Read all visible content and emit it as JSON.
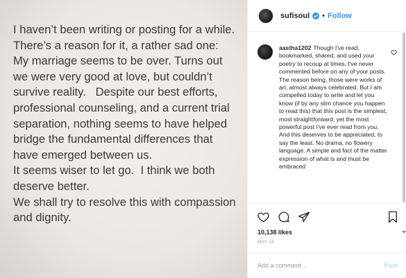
{
  "post": {
    "image_text": [
      "I haven’t been writing or posting for a while. There’s a reason for it, a rather sad one:  My marriage seems to be over. Turns out we were very good at love, but couldn’t survive reality.   Despite our best efforts, professional counseling, and a current trial separation, nothing seems to have helped bridge the fundamental differences that have emerged between us.",
      "It seems wiser to let go.  I think we both deserve better.",
      "We shall try to resolve this with compassion and dignity."
    ]
  },
  "header": {
    "username": "sufisoul",
    "separator": "•",
    "follow_label": "Follow",
    "verified_icon": "verified-badge-icon",
    "accent_color": "#3897f0"
  },
  "comments": [
    {
      "username": "aastha1202",
      "text": "Though I've read, bookmarked, shared, and used your poetry to recoup at times, I've never commented before on any of your posts. The reason being, those were works of art, almost always celebrated. But I am compelled today to write and let you know (if by any slim chance you happen to read this) that this post is the simplest, most straightforward, yet the most powerful post I've ever read from you. And this deserves to be appreciated, to say the least. No drama, no flowery language. A simple and fact of the matter expression of what is and must be embraced"
    }
  ],
  "actions": {
    "like_icon": "heart-icon",
    "comment_icon": "comment-icon",
    "share_icon": "share-icon",
    "save_icon": "bookmark-icon"
  },
  "likes": "10,138 likes",
  "date": "MAY 10",
  "comment_box": {
    "placeholder": "Add a comment…",
    "post_label": "Post"
  }
}
